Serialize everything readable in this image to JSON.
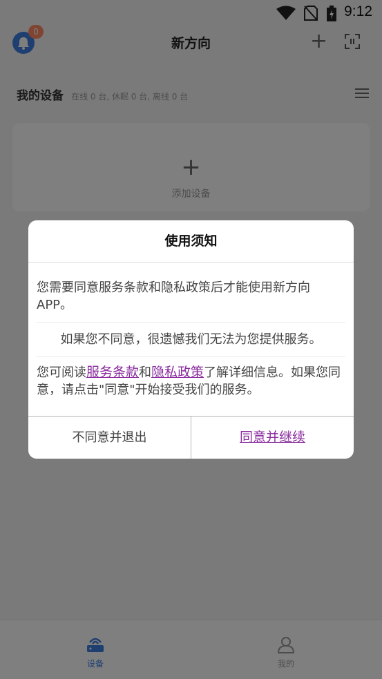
{
  "status": {
    "time": "9:12"
  },
  "header": {
    "title": "新方向",
    "badge_count": "0"
  },
  "devices": {
    "label": "我的设备",
    "summary": "在线 0 台, 休眠 0 台, 离线 0 台"
  },
  "add_card": {
    "label": "添加设备"
  },
  "tabs": [
    {
      "label": "设备"
    },
    {
      "label": "我的"
    }
  ],
  "dialog": {
    "title": "使用须知",
    "para1": "您需要同意服务条款和隐私政策后才能使用新方向APP。",
    "para2": "如果您不同意，很遗憾我们无法为您提供服务。",
    "para3_prefix": "您可阅读",
    "terms_link": "服务条款",
    "para3_and": "和",
    "privacy_link": "隐私政策",
    "para3_suffix": "了解详细信息。如果您同意，请点击\"同意\"开始接受我们的服务。",
    "decline_button": "不同意并退出",
    "accept_button": "同意并继续"
  },
  "colors": {
    "accent": "#3d7fe0",
    "link": "#8a2b9e",
    "badge": "#ff8a65"
  },
  "icons": [
    "wifi-icon",
    "no-sim-icon",
    "battery-icon",
    "bell-icon",
    "plus-icon",
    "scan-icon",
    "menu-icon",
    "router-icon",
    "user-icon"
  ]
}
